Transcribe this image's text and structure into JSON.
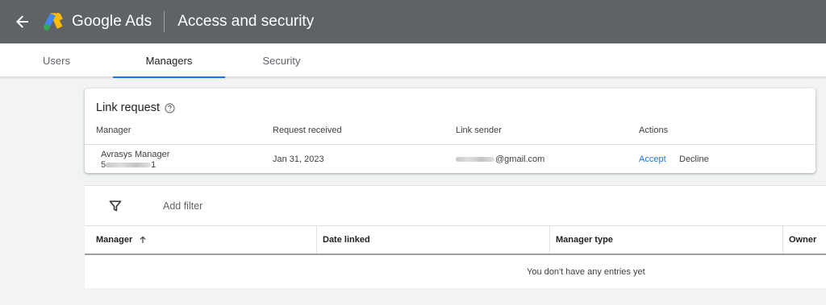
{
  "appbar": {
    "brand": "Google Ads",
    "title": "Access and security",
    "back_icon": "arrow-left-icon",
    "logo_colors": [
      "#fbbc04",
      "#4285f4",
      "#34a853"
    ]
  },
  "tabs": [
    {
      "label": "Users",
      "active": false
    },
    {
      "label": "Managers",
      "active": true
    },
    {
      "label": "Security",
      "active": false
    }
  ],
  "link_request": {
    "title": "Link request",
    "help_icon": "help-circle-icon",
    "columns": [
      "Manager",
      "Request received",
      "Link sender",
      "Actions"
    ],
    "row": {
      "manager_name": "Avrasys Manager",
      "manager_id_visible": "5",
      "manager_id_tail": "1",
      "request_received": "Jan 31, 2023",
      "sender_suffix": "@gmail.com",
      "accept": "Accept",
      "decline": "Decline"
    }
  },
  "managers_table": {
    "filter_icon": "filter-icon",
    "add_filter": "Add filter",
    "columns": [
      {
        "label": "Manager",
        "sort": "ascending"
      },
      {
        "label": "Date linked"
      },
      {
        "label": "Manager type"
      },
      {
        "label": "Owner"
      }
    ],
    "empty_message": "You don't have any entries yet"
  },
  "colors": {
    "appbar": "#5f6368",
    "accent": "#1a73e8",
    "background": "#f1f3f4"
  }
}
